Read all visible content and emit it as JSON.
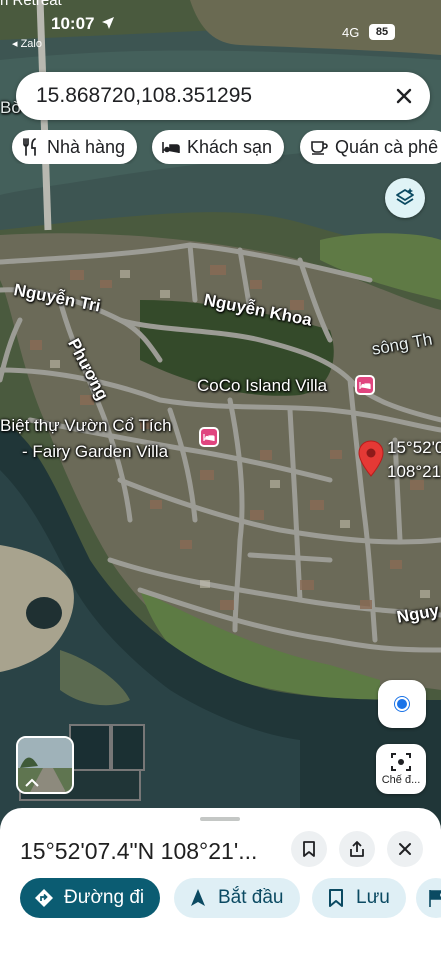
{
  "status_bar": {
    "top_fragment": "n Retreat",
    "time": "10:07",
    "back_app": "◂ Zalo",
    "network": "4G",
    "battery": "85"
  },
  "search": {
    "value": "15.868720,108.351295"
  },
  "chips": [
    {
      "label": "Nhà hàng",
      "icon": "restaurant-icon"
    },
    {
      "label": "Khách sạn",
      "icon": "hotel-icon"
    },
    {
      "label": "Quán cà phê",
      "icon": "coffee-icon"
    }
  ],
  "map": {
    "streets": {
      "nguyen_tri_phuong_a": "Nguyễn Tri",
      "nguyen_tri_phuong_b": "Phương",
      "nguyen_khoa": "Nguyễn Khoa",
      "song": "sông Th",
      "nguy": "Nguy",
      "bo": "Bờ"
    },
    "pois": {
      "coco": "CoCo Island Villa",
      "fairy_1": "Biệt thự Vườn Cổ Tích",
      "fairy_2": "- Fairy Garden Villa"
    },
    "pin_label_1": "15°52'0",
    "pin_label_2": "108°21",
    "scan_label": "Chế đ..."
  },
  "sheet": {
    "title": "15°52'07.4\"N 108°21'...",
    "actions": [
      {
        "label": "Đường đi",
        "icon": "directions-icon"
      },
      {
        "label": "Bắt đầu",
        "icon": "navigate-arrow-icon"
      },
      {
        "label": "Lưu",
        "icon": "bookmark-icon"
      }
    ]
  },
  "colors": {
    "accent_dark": "#0b5c72",
    "accent_light": "#dfeff5",
    "marker": "#e53935",
    "hotel_pin": "#e0457f"
  }
}
